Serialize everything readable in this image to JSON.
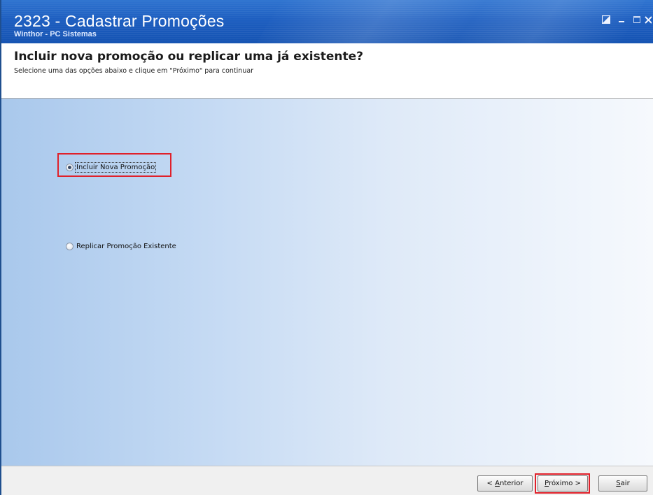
{
  "window": {
    "title": "2323 - Cadastrar Promoções",
    "subtitle": "Winthor - PC Sistemas"
  },
  "header": {
    "title": "Incluir nova promoção ou replicar uma já existente?",
    "instruction": "Selecione uma das opções abaixo e clique em \"Próximo\" para continuar"
  },
  "options": {
    "include_new": {
      "label": "Incluir Nova Promoção",
      "selected": true
    },
    "replicate": {
      "label": "Replicar Promoção Existente",
      "selected": false
    }
  },
  "footer": {
    "back": {
      "mnemonic": "A",
      "prefix": "< ",
      "rest": "nterior"
    },
    "next": {
      "mnemonic": "P",
      "rest": "róximo >"
    },
    "exit": {
      "mnemonic": "S",
      "rest": "air"
    }
  },
  "icons": {
    "restore": "restore-icon",
    "minimize": "minimize-icon",
    "maximize": "maximize-icon",
    "close": "close-icon"
  },
  "colors": {
    "titlebar": "#1d5ec0",
    "highlight": "#e0202a",
    "content_gradient_start": "#a9c8ec",
    "content_gradient_end": "#f6f9fd"
  }
}
